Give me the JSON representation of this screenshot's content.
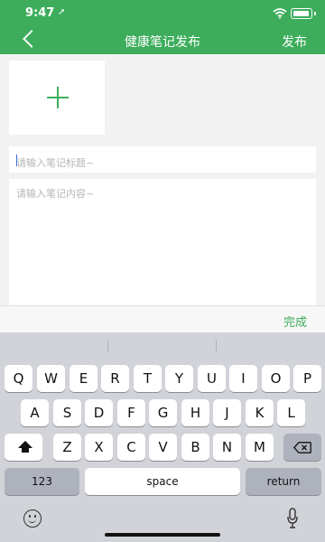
{
  "status": {
    "time": "9:47",
    "location_glyph": "➚"
  },
  "nav": {
    "title": "健康笔记发布",
    "publish_label": "发布"
  },
  "add_photo": {
    "icon": "plus-icon"
  },
  "inputs": {
    "title_placeholder": "请输入笔记标题~",
    "content_placeholder": "请输入笔记内容~"
  },
  "toolbar": {
    "done_label": "完成"
  },
  "keyboard": {
    "row1": [
      "Q",
      "W",
      "E",
      "R",
      "T",
      "Y",
      "U",
      "I",
      "O",
      "P"
    ],
    "row2": [
      "A",
      "S",
      "D",
      "F",
      "G",
      "H",
      "J",
      "K",
      "L"
    ],
    "row3": [
      "Z",
      "X",
      "C",
      "V",
      "B",
      "N",
      "M"
    ],
    "numbers_label": "123",
    "space_label": "space",
    "return_label": "return"
  },
  "colors": {
    "brand_green": "#3dad5c",
    "keyboard_bg": "#d1d3d9"
  }
}
